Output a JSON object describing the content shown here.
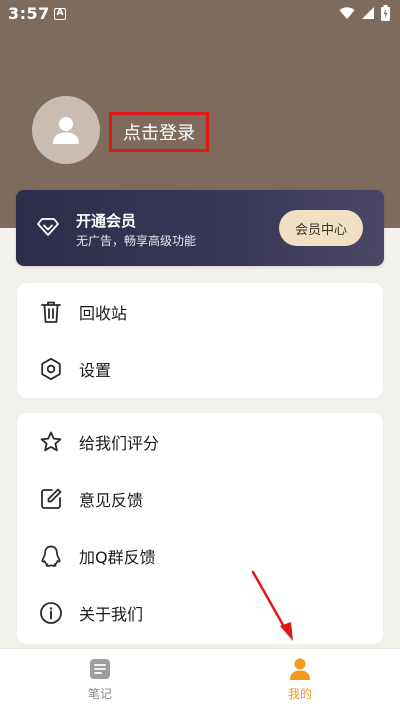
{
  "status_bar": {
    "time": "3:57",
    "notification_badge": "A"
  },
  "profile": {
    "login_label": "点击登录"
  },
  "vip": {
    "title": "开通会员",
    "subtitle": "无广告，畅享高级功能",
    "button_label": "会员中心"
  },
  "menu_group_1": [
    {
      "label": "回收站",
      "icon": "trash-icon"
    },
    {
      "label": "设置",
      "icon": "gear-icon"
    }
  ],
  "menu_group_2": [
    {
      "label": "给我们评分",
      "icon": "star-icon"
    },
    {
      "label": "意见反馈",
      "icon": "edit-icon"
    },
    {
      "label": "加Q群反馈",
      "icon": "qq-icon"
    },
    {
      "label": "关于我们",
      "icon": "info-icon"
    }
  ],
  "tabbar": {
    "items": [
      {
        "label": "笔记",
        "icon": "note-icon",
        "active": false
      },
      {
        "label": "我的",
        "icon": "person-icon",
        "active": true
      }
    ]
  },
  "colors": {
    "header": "#7f6b5c",
    "vip_card": "#2e2c4b",
    "vip_button": "#f1e0c4",
    "accent": "#f29a1a",
    "highlight_box": "#e01818"
  }
}
